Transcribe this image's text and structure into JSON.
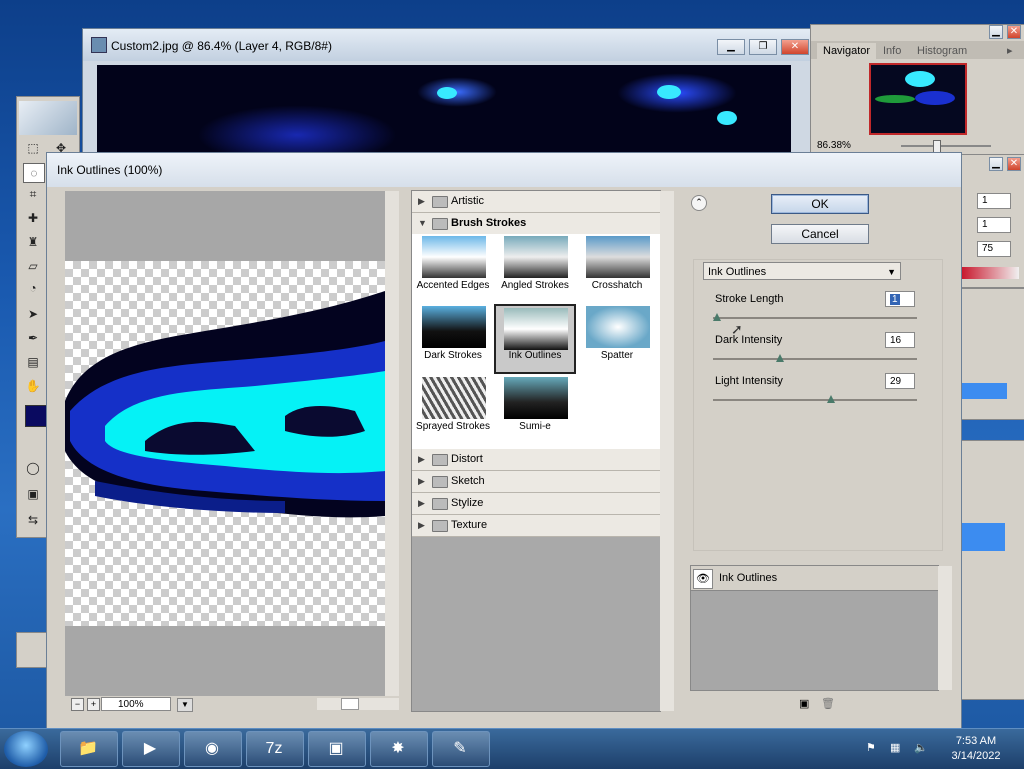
{
  "document_window": {
    "title": "Custom2.jpg @ 86.4% (Layer 4, RGB/8#)",
    "buttons": [
      "minimize",
      "restore",
      "close"
    ]
  },
  "navigator_panel": {
    "tabs": [
      "Navigator",
      "Info",
      "Histogram"
    ],
    "zoom": "86.38%"
  },
  "info_panel": {
    "values": [
      "1",
      "1",
      "75"
    ]
  },
  "dialog": {
    "title": "Ink Outlines (100%)",
    "zoom": "100%",
    "ok_label": "OK",
    "cancel_label": "Cancel",
    "categories_top": [
      {
        "label": "Artistic",
        "open": false
      },
      {
        "label": "Brush Strokes",
        "open": true
      }
    ],
    "thumbnails": [
      {
        "label": "Accented Edges",
        "selected": false
      },
      {
        "label": "Angled Strokes",
        "selected": false
      },
      {
        "label": "Crosshatch",
        "selected": false
      },
      {
        "label": "Dark Strokes",
        "selected": false
      },
      {
        "label": "Ink Outlines",
        "selected": true
      },
      {
        "label": "Spatter",
        "selected": false
      },
      {
        "label": "Sprayed Strokes",
        "selected": false
      },
      {
        "label": "Sumi-e",
        "selected": false
      }
    ],
    "categories_bottom": [
      {
        "label": "Distort"
      },
      {
        "label": "Sketch"
      },
      {
        "label": "Stylize"
      },
      {
        "label": "Texture"
      }
    ],
    "filter_select": "Ink Outlines",
    "params": [
      {
        "label": "Stroke Length",
        "value": "1",
        "fraction": 0.0
      },
      {
        "label": "Dark Intensity",
        "value": "16",
        "fraction": 0.32
      },
      {
        "label": "Light Intensity",
        "value": "29",
        "fraction": 0.58
      }
    ],
    "effect_layer": "Ink Outlines"
  },
  "taskbar": {
    "apps": [
      "windows-explorer",
      "media-player",
      "chrome",
      "7-zip",
      "image-viewer",
      "paint",
      "photoshop"
    ],
    "app_glyphs": [
      "📁",
      "▶",
      "◉",
      "7z",
      "▣",
      "✸",
      "✎"
    ],
    "time": "7:53 AM",
    "date": "3/14/2022"
  }
}
